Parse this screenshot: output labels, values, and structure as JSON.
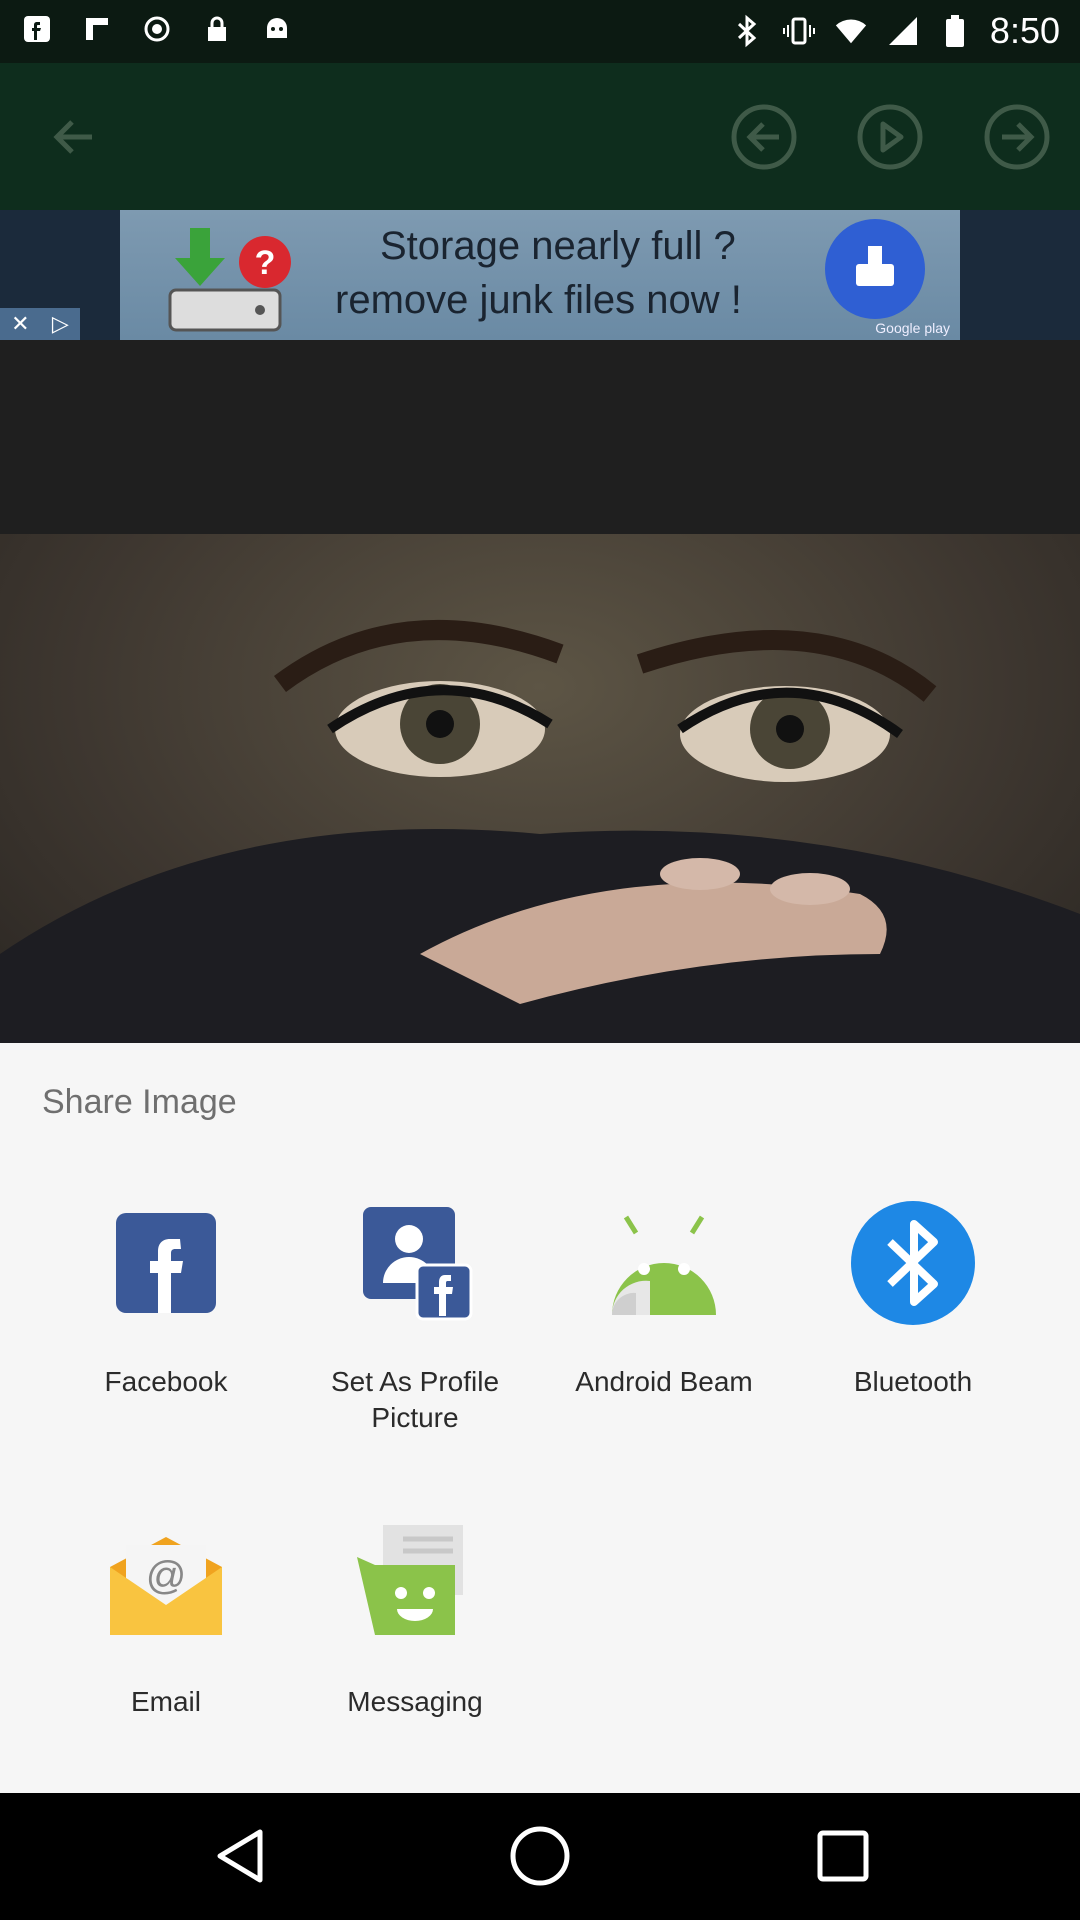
{
  "status_bar": {
    "time": "8:50",
    "left_icons": [
      "facebook-icon",
      "flipboard-icon",
      "blocked-icon",
      "lock-icon",
      "android-icon"
    ],
    "right_icons": [
      "bluetooth-icon",
      "vibrate-icon",
      "wifi-icon",
      "signal-icon",
      "battery-icon"
    ]
  },
  "app_bar": {
    "icons": [
      "back-arrow-icon",
      "previous-icon",
      "play-icon",
      "next-icon"
    ]
  },
  "ad_banner": {
    "line1": "Storage nearly full ?",
    "line2": "remove junk files now !",
    "store_badge": "Google play",
    "close_label": "✕",
    "adchoices_label": "▷"
  },
  "share_sheet": {
    "title": "Share Image",
    "apps": [
      {
        "label": "Facebook",
        "icon": "facebook-icon",
        "color": "#3b5998"
      },
      {
        "label": "Set As Profile\nPicture",
        "icon": "profile-picture-icon",
        "color": "#3b5998"
      },
      {
        "label": "Android Beam",
        "icon": "android-beam-icon",
        "color": "#8bc34a"
      },
      {
        "label": "Bluetooth",
        "icon": "bluetooth-icon",
        "color": "#1e88e5"
      },
      {
        "label": "Email",
        "icon": "email-icon",
        "color": "#f9c440"
      },
      {
        "label": "Messaging",
        "icon": "messaging-icon",
        "color": "#8bc34a"
      }
    ]
  },
  "nav_bar": {
    "icons": [
      "back-triangle-icon",
      "home-circle-icon",
      "recents-square-icon"
    ]
  }
}
